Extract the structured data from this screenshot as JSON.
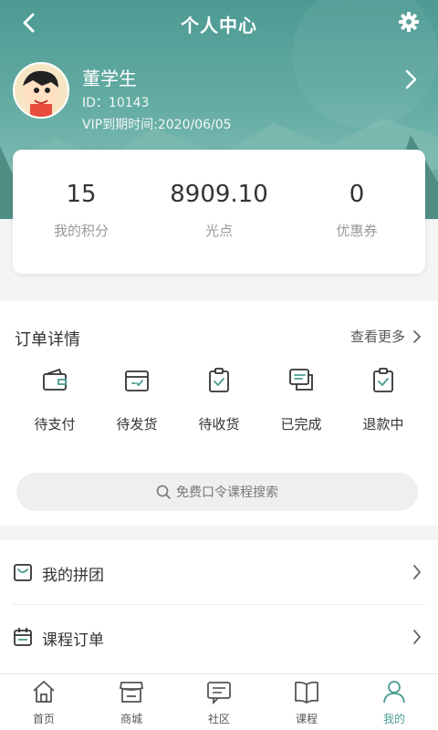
{
  "nav": {
    "title": "个人中心",
    "back_icon": "chevron-left-icon",
    "settings_icon": "gear-icon"
  },
  "profile": {
    "name": "董学生",
    "id_text": "ID：10143",
    "vip_text": "VIP到期时间:2020/06/05"
  },
  "stats": [
    {
      "value": "15",
      "label": "我的积分"
    },
    {
      "value": "8909.10",
      "label": "光点"
    },
    {
      "value": "0",
      "label": "优惠券"
    }
  ],
  "orders": {
    "title": "订单详情",
    "more_label": "查看更多",
    "items": [
      {
        "label": "待支付",
        "icon": "wallet-icon"
      },
      {
        "label": "待发货",
        "icon": "box-icon"
      },
      {
        "label": "待收货",
        "icon": "clipboard-check-icon"
      },
      {
        "label": "已完成",
        "icon": "chat-done-icon"
      },
      {
        "label": "退款中",
        "icon": "clipboard-refund-icon"
      }
    ]
  },
  "search": {
    "placeholder": "免费口令课程搜索"
  },
  "menu": [
    {
      "label": "我的拼团",
      "icon": "bag-icon"
    },
    {
      "label": "课程订单",
      "icon": "calendar-icon"
    }
  ],
  "tabs": [
    {
      "label": "首页",
      "icon": "home-icon"
    },
    {
      "label": "商城",
      "icon": "store-icon"
    },
    {
      "label": "社区",
      "icon": "chat-icon"
    },
    {
      "label": "课程",
      "icon": "book-icon"
    },
    {
      "label": "我的",
      "icon": "user-icon",
      "active": true
    }
  ],
  "colors": {
    "accent": "#4a9d92",
    "header_top": "#4d9a93",
    "header_bottom": "#8cc4bb"
  }
}
